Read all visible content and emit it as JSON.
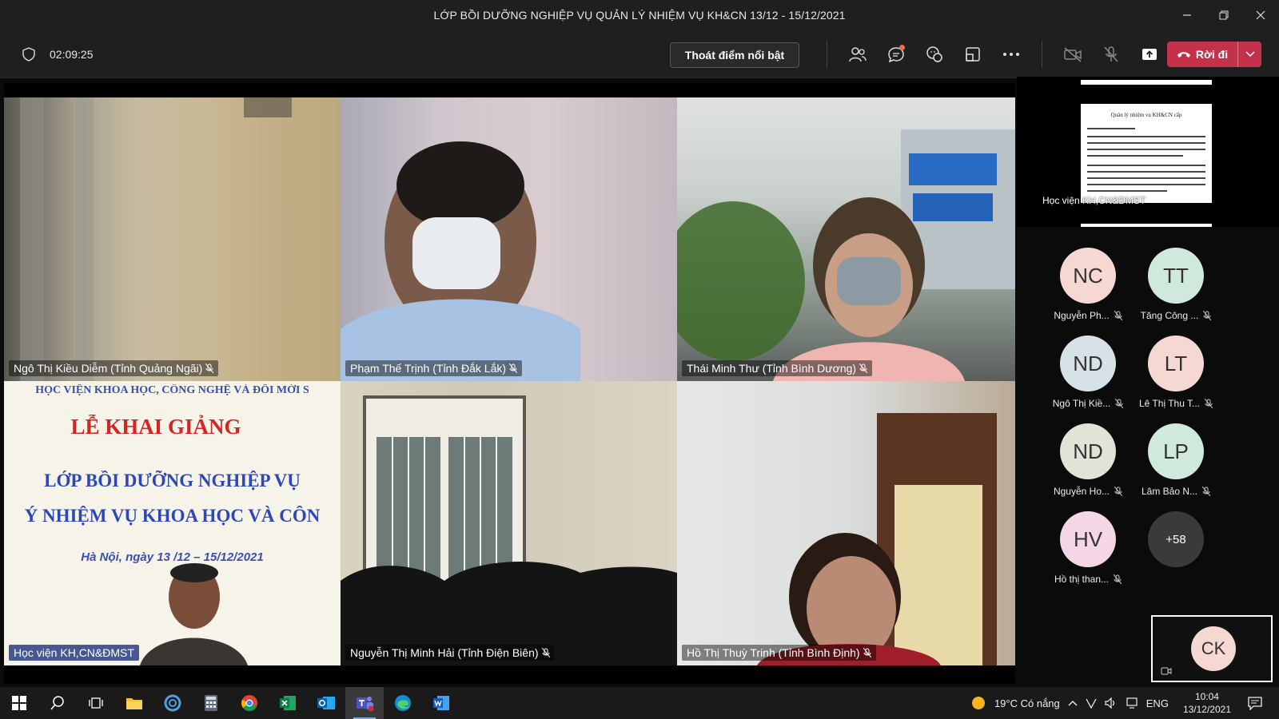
{
  "window": {
    "title": "LỚP BỒI DƯỠNG NGHIỆP VỤ QUẢN LÝ NHIỆM VỤ KH&CN 13/12 - 15/12/2021"
  },
  "toolbar": {
    "timer": "02:09:25",
    "exit_spotlight_label": "Thoát điểm nổi bật",
    "leave_label": "Rời đi"
  },
  "tiles": [
    {
      "name": "Ngô Thị Kiều Diễm (Tỉnh Quảng Ngãi)"
    },
    {
      "name": "Phạm Thế Trịnh (Tỉnh Đắk Lắk)"
    },
    {
      "name": "Thái Minh Thư (Tỉnh Bình Dương)"
    },
    {
      "name": "Học viện KH,CN&ĐMST"
    },
    {
      "name": "Nguyễn Thị Minh Hải (Tỉnh Điện Biên)"
    },
    {
      "name": "Hồ Thị Thuỳ Trinh (Tỉnh Bình Định)"
    }
  ],
  "slide": {
    "header": "HỌC VIỆN KHOA HỌC, CÔNG NGHỆ VÀ ĐỔI MỚI S",
    "title": "LỄ KHAI GIẢNG",
    "line1": "LỚP BỒI DƯỠNG NGHIỆP VỤ",
    "line2": "Ý NHIỆM VỤ KHOA HỌC VÀ CÔN",
    "date": "Hà Nội, ngày 13 /12 – 15/12/2021"
  },
  "shared_content": {
    "presenter_label": "Học viện KH,CN&ĐMST",
    "doc_title": "Quản lý nhiệm vụ KH&CN cấp"
  },
  "participants": [
    {
      "initials": "NC",
      "name": "Nguyễn Ph...",
      "color": "#f6d8d2"
    },
    {
      "initials": "TT",
      "name": "Tăng Công ...",
      "color": "#cfe9dc"
    },
    {
      "initials": "ND",
      "name": "Ngô Thị Kiề...",
      "color": "#d6e2e6"
    },
    {
      "initials": "LT",
      "name": "Lê Thị Thu T...",
      "color": "#f6d8d2"
    },
    {
      "initials": "ND",
      "name": "Nguyễn Ho...",
      "color": "#e2e2d6"
    },
    {
      "initials": "LP",
      "name": "Lâm Bảo N...",
      "color": "#cfe9dc"
    },
    {
      "initials": "HV",
      "name": "Hồ thị than...",
      "color": "#f5d6e6"
    }
  ],
  "more_participants": "+58",
  "self_view": {
    "initials": "CK",
    "color": "#f6d8d2"
  },
  "taskbar": {
    "weather": "19°C Có nắng",
    "language": "ENG",
    "time": "10:04",
    "date": "13/12/2021"
  }
}
